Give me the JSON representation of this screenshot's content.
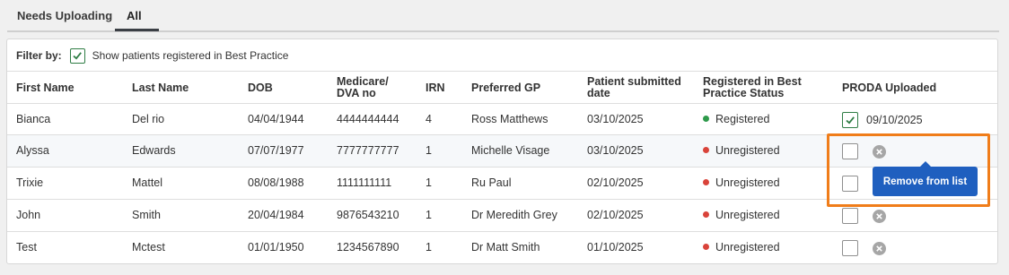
{
  "tabs": [
    {
      "label": "Needs Uploading"
    },
    {
      "label": "All"
    }
  ],
  "filter": {
    "label": "Filter by:",
    "option_label": "Show patients registered in Best Practice",
    "checked": true
  },
  "columns": {
    "first_name": "First Name",
    "last_name": "Last Name",
    "dob": "DOB",
    "medicare_1": "Medicare/",
    "medicare_2": "DVA no",
    "irn": "IRN",
    "preferred_gp": "Preferred GP",
    "submitted_1": "Patient submitted",
    "submitted_2": "date",
    "registered_1": "Registered in Best",
    "registered_2": "Practice Status",
    "proda": "PRODA Uploaded"
  },
  "rows": [
    {
      "first": "Bianca",
      "last": "Del rio",
      "dob": "04/04/1944",
      "medicare": "4444444444",
      "irn": "4",
      "gp": "Ross Matthews",
      "submitted": "03/10/2025",
      "status": "Registered",
      "status_color": "#2e9a4b",
      "proda_checked": true,
      "proda_date": "09/10/2025"
    },
    {
      "first": "Alyssa",
      "last": "Edwards",
      "dob": "07/07/1977",
      "medicare": "7777777777",
      "irn": "1",
      "gp": "Michelle Visage",
      "submitted": "03/10/2025",
      "status": "Unregistered",
      "status_color": "#d9433a",
      "proda_checked": false,
      "proda_date": ""
    },
    {
      "first": "Trixie",
      "last": "Mattel",
      "dob": "08/08/1988",
      "medicare": "1111111111",
      "irn": "1",
      "gp": "Ru Paul",
      "submitted": "02/10/2025",
      "status": "Unregistered",
      "status_color": "#d9433a",
      "proda_checked": false,
      "proda_date": ""
    },
    {
      "first": "John",
      "last": "Smith",
      "dob": "20/04/1984",
      "medicare": "9876543210",
      "irn": "1",
      "gp": "Dr Meredith Grey",
      "submitted": "02/10/2025",
      "status": "Unregistered",
      "status_color": "#d9433a",
      "proda_checked": false,
      "proda_date": ""
    },
    {
      "first": "Test",
      "last": "Mctest",
      "dob": "01/01/1950",
      "medicare": "1234567890",
      "irn": "1",
      "gp": "Dr Matt Smith",
      "submitted": "01/10/2025",
      "status": "Unregistered",
      "status_color": "#d9433a",
      "proda_checked": false,
      "proda_date": ""
    }
  ],
  "tooltip": {
    "label": "Remove from list"
  },
  "colors": {
    "accent": "#1f5fbf",
    "highlight": "#f07d1a",
    "check": "#2f7d45"
  }
}
